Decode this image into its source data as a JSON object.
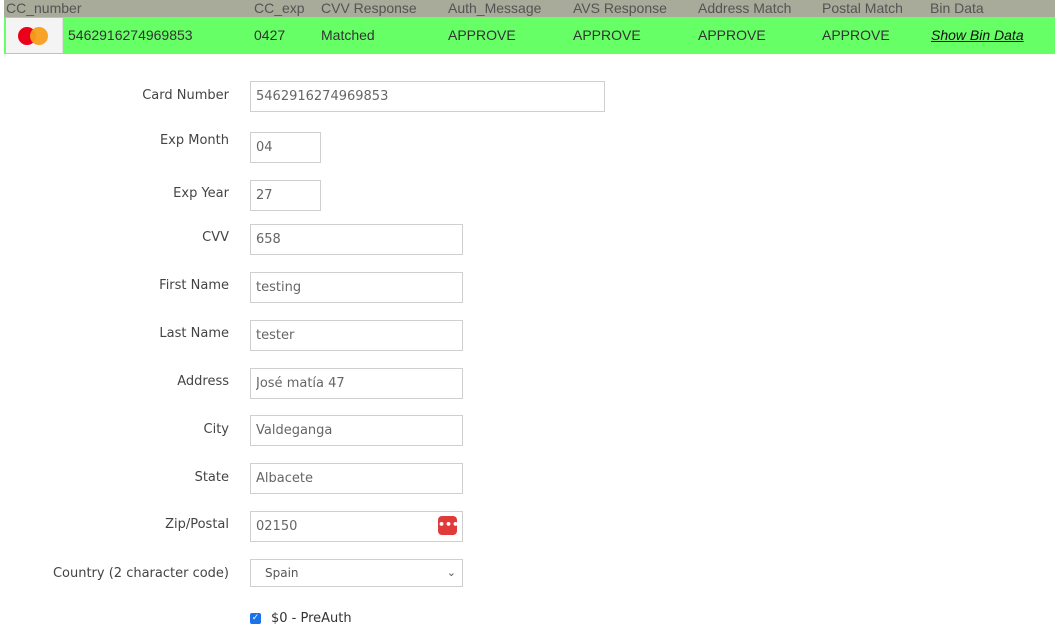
{
  "results_table": {
    "headers": [
      "CC_number",
      "CC_exp",
      "CVV Response",
      "Auth_Message",
      "AVS Response",
      "Address Match",
      "Postal Match",
      "Bin Data"
    ],
    "row": {
      "card_brand_icon": "mastercard-icon",
      "cc_number": "5462916274969853",
      "cc_exp": "0427",
      "cvv_response": "Matched",
      "auth_message": "APPROVE",
      "avs_response": "APPROVE",
      "address_match": "APPROVE",
      "postal_match": "APPROVE",
      "bin_data_link": "Show Bin Data"
    },
    "colors": {
      "header_bg": "#a8aa9a",
      "row_bg": "#66ff66"
    }
  },
  "form": {
    "card_number": {
      "label": "Card Number",
      "value": "5462916274969853"
    },
    "exp_month": {
      "label": "Exp Month",
      "value": "04"
    },
    "exp_year": {
      "label": "Exp Year",
      "value": "27"
    },
    "cvv": {
      "label": "CVV",
      "value": "658"
    },
    "first_name": {
      "label": "First Name",
      "value": "testing"
    },
    "last_name": {
      "label": "Last Name",
      "value": "tester"
    },
    "address": {
      "label": "Address",
      "value": "José matía 47"
    },
    "city": {
      "label": "City",
      "value": "Valdeganga"
    },
    "state": {
      "label": "State",
      "value": "Albacete"
    },
    "zip": {
      "label": "Zip/Postal",
      "value": "02150",
      "icon": "password-manager-icon"
    },
    "country": {
      "label": "Country (2 character code)",
      "selected": "Spain"
    },
    "preauth": {
      "label": "$0 - PreAuth",
      "checked": true
    }
  }
}
